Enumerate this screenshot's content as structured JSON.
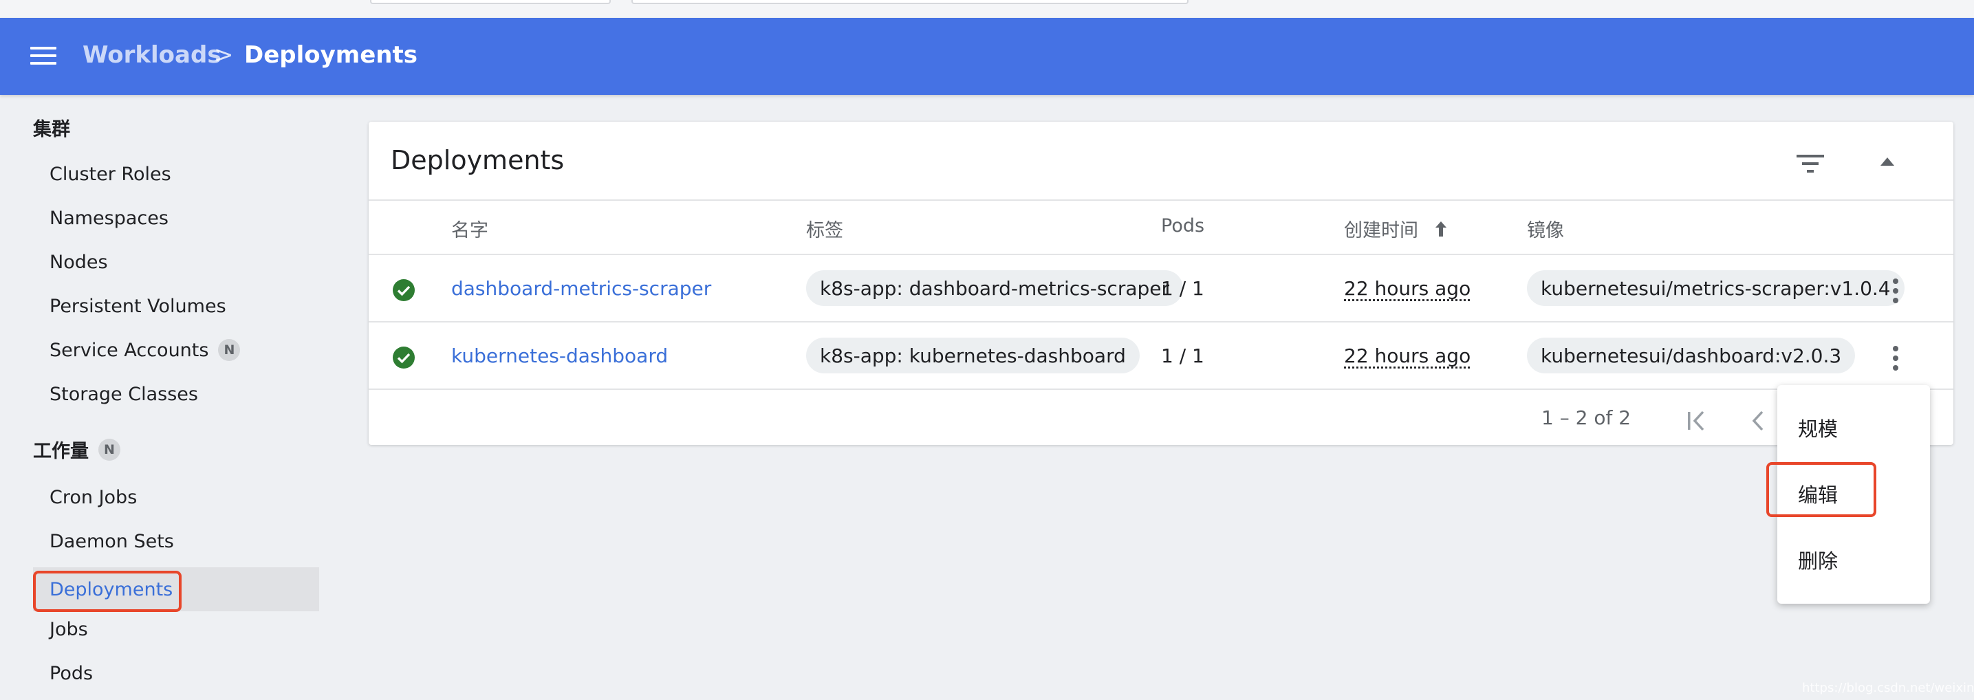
{
  "header": {
    "crumb_parent": "Workloads",
    "crumb_separator": ">",
    "crumb_current": "Deployments"
  },
  "sidebar": {
    "cluster_heading": "集群",
    "cluster_items": [
      {
        "label": "Cluster Roles"
      },
      {
        "label": "Namespaces"
      },
      {
        "label": "Nodes"
      },
      {
        "label": "Persistent Volumes"
      },
      {
        "label": "Service Accounts",
        "badge": "N"
      },
      {
        "label": "Storage Classes"
      }
    ],
    "workload_heading": "工作量",
    "workload_badge": "N",
    "workload_items": [
      {
        "label": "Cron Jobs"
      },
      {
        "label": "Daemon Sets"
      },
      {
        "label": "Deployments",
        "active": true
      },
      {
        "label": "Jobs"
      },
      {
        "label": "Pods"
      }
    ]
  },
  "card": {
    "title": "Deployments",
    "columns": {
      "name": "名字",
      "labels": "标签",
      "pods": "Pods",
      "created": "创建时间",
      "images": "镜像"
    },
    "rows": [
      {
        "name": "dashboard-metrics-scraper",
        "label": "k8s-app: dashboard-metrics-scraper",
        "pods": "1 / 1",
        "created": "22 hours ago",
        "image": "kubernetesui/metrics-scraper:v1.0.4"
      },
      {
        "name": "kubernetes-dashboard",
        "label": "k8s-app: kubernetes-dashboard",
        "pods": "1 / 1",
        "created": "22 hours ago",
        "image": "kubernetesui/dashboard:v2.0.3"
      }
    ],
    "pager": "1 – 2 of 2"
  },
  "menu": {
    "items": [
      "规模",
      "编辑",
      "删除"
    ]
  },
  "watermark": "https://blog.csdn.net/weixin_4????",
  "colors": {
    "header": "#4572e4",
    "link": "#3a6fd8",
    "status_ok": "#2e7d32",
    "highlight": "#e8462a"
  }
}
